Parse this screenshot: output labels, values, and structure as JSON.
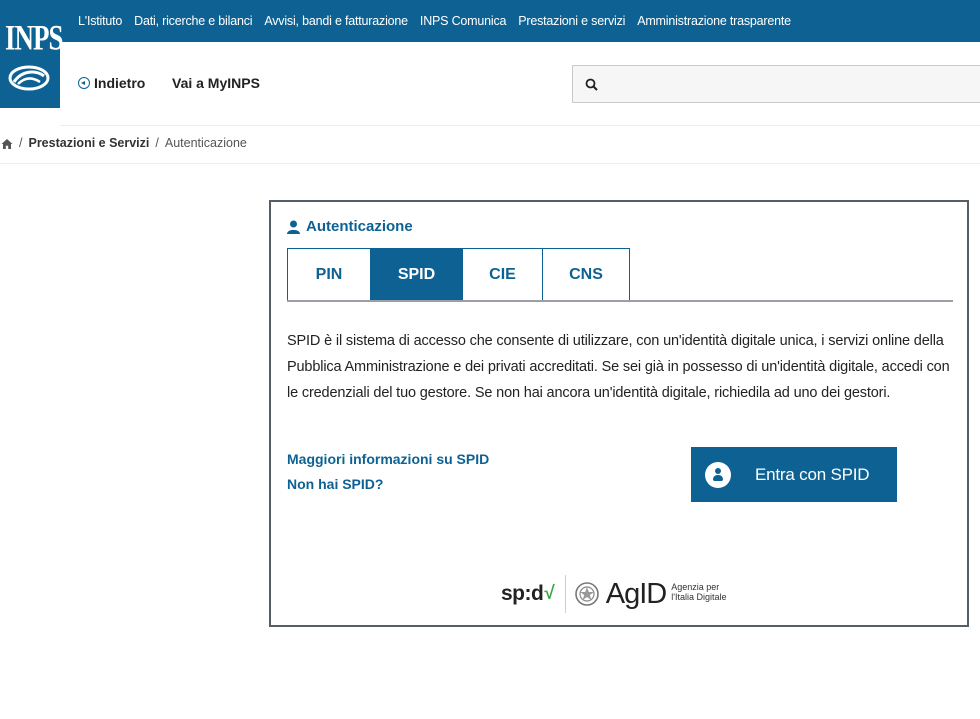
{
  "brand": {
    "logo_text": "INPS",
    "primary_color": "#0e6293",
    "accent_green": "#3aa845"
  },
  "topnav": {
    "items": [
      "L'Istituto",
      "Dati, ricerche e bilanci",
      "Avvisi, bandi e fatturazione",
      "INPS Comunica",
      "Prestazioni e servizi",
      "Amministrazione trasparente"
    ]
  },
  "header": {
    "back_label": "Indietro",
    "myinps_label": "Vai a MyINPS",
    "search_placeholder": ""
  },
  "breadcrumb": {
    "items": [
      "Prestazioni e Servizi",
      "Autenticazione"
    ],
    "separator": "/"
  },
  "auth": {
    "title": "Autenticazione",
    "tabs": [
      {
        "label": "PIN",
        "active": false
      },
      {
        "label": "SPID",
        "active": true
      },
      {
        "label": "CIE",
        "active": false
      },
      {
        "label": "CNS",
        "active": false
      }
    ],
    "description": "SPID è il sistema di accesso che consente di utilizzare, con un'identità digitale unica, i servizi online della Pubblica Amministrazione e dei privati accreditati. Se sei già in possesso di un'identità digitale, accedi con le credenziali del tuo gestore. Se non hai ancora un'identità digitale, richiedila ad uno dei gestori.",
    "link_more_info": "Maggiori informazioni su SPID",
    "link_no_spid": "Non hai SPID?",
    "login_button": "Entra con SPID"
  },
  "footer_logos": {
    "spid": "sp:d",
    "spid_check": "√",
    "agid": "AgID",
    "agid_sub_line1": "Agenzia per",
    "agid_sub_line2": "l'Italia Digitale"
  }
}
